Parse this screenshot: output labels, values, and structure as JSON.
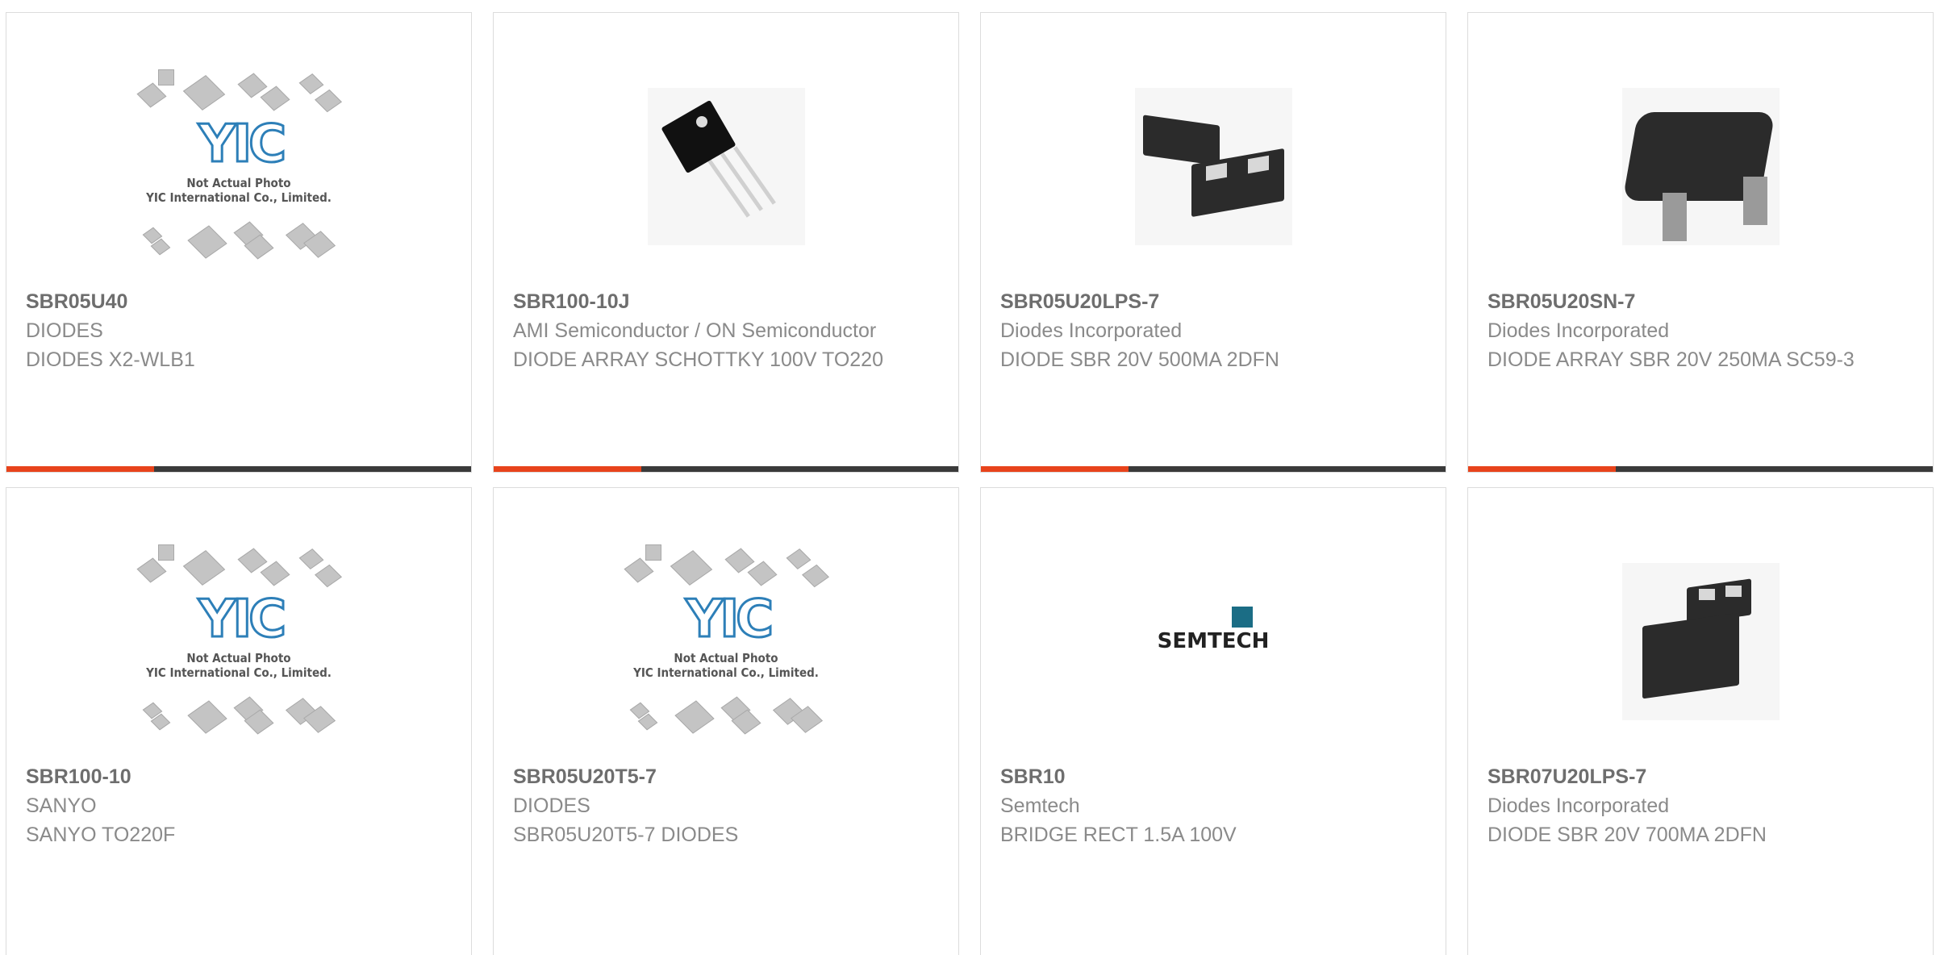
{
  "products": [
    {
      "part": "SBR05U40",
      "manufacturer": "DIODES",
      "description": "DIODES X2-WLB1",
      "image": "placeholder"
    },
    {
      "part": "SBR100-10J",
      "manufacturer": "AMI Semiconductor / ON Semiconductor",
      "description": "DIODE ARRAY SCHOTTKY 100V TO220",
      "image": "to220"
    },
    {
      "part": "SBR05U20LPS-7",
      "manufacturer": "Diodes Incorporated",
      "description": "DIODE SBR 20V 500MA 2DFN",
      "image": "dfn"
    },
    {
      "part": "SBR05U20SN-7",
      "manufacturer": "Diodes Incorporated",
      "description": "DIODE ARRAY SBR 20V 250MA SC59-3",
      "image": "sc59"
    },
    {
      "part": "SBR100-10",
      "manufacturer": "SANYO",
      "description": "SANYO TO220F",
      "image": "placeholder"
    },
    {
      "part": "SBR05U20T5-7",
      "manufacturer": "DIODES",
      "description": "SBR05U20T5-7 DIODES",
      "image": "placeholder"
    },
    {
      "part": "SBR10",
      "manufacturer": "Semtech",
      "description": "BRIDGE RECT 1.5A 100V",
      "image": "semtech"
    },
    {
      "part": "SBR07U20LPS-7",
      "manufacturer": "Diodes Incorporated",
      "description": "DIODE SBR 20V 700MA 2DFN",
      "image": "dfn2"
    }
  ],
  "placeholder": {
    "logo": "YIC",
    "line1": "Not Actual Photo",
    "line2": "YIC International Co., Limited."
  },
  "semtech_logo": "SEMTECH",
  "colors": {
    "accent": "#e8431b",
    "bar": "#3a3a3a",
    "text": "#8a8a8a",
    "part": "#6e6e6e",
    "border": "#dcdcdc"
  }
}
